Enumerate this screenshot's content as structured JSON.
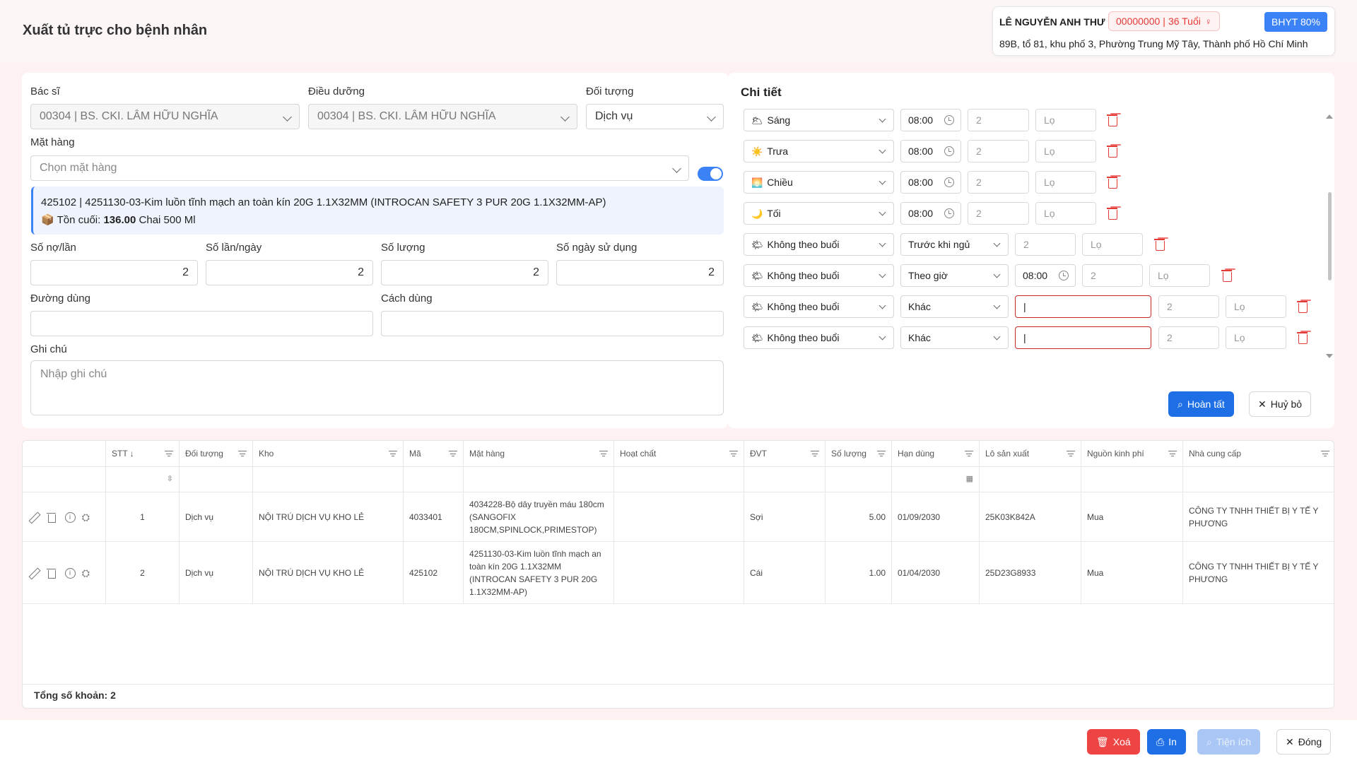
{
  "page": {
    "title": "Xuất tủ trực cho bệnh nhân"
  },
  "patient": {
    "name": "LÊ NGUYỄN ANH THƯ",
    "code": "00000000",
    "age": "36 Tuổi",
    "insurance": "BHYT 80%",
    "address": "89B, tổ 81, khu phố 3, Phường Trung Mỹ Tây, Thành phố Hồ Chí Minh"
  },
  "form": {
    "doctor_label": "Bác sĩ",
    "doctor_value": "00304 | BS. CKI. LÂM HỮU NGHĨA",
    "nurse_label": "Điều dưỡng",
    "nurse_value": "00304 | BS. CKI. LÂM HỮU NGHĨA",
    "object_label": "Đối tượng",
    "object_value": "Dịch vụ",
    "item_label": "Mặt hàng",
    "item_placeholder": "Chọn mặt hàng",
    "toggle_on": true,
    "selected_item": "425102 | 4251130-03-Kim luồn tĩnh mạch an toàn kín 20G 1.1X32MM (INTROCAN SAFETY 3 PUR 20G 1.1X32MM-AP)",
    "stock_label": "Tồn cuối:",
    "stock_value": "136.00",
    "stock_unit": "Chai 500 Ml",
    "dose_label": "Số nợ/lần",
    "dose_value": "2",
    "times_label": "Số lần/ngày",
    "times_value": "2",
    "qty_label": "Số lượng",
    "qty_value": "2",
    "days_label": "Số ngày sử dụng",
    "days_value": "2",
    "route_label": "Đường dùng",
    "route_value": "",
    "usage_label": "Cách dùng",
    "usage_value": "",
    "note_label": "Ghi chú",
    "note_placeholder": "Nhập ghi chú"
  },
  "detail": {
    "title": "Chi tiết",
    "rows": [
      {
        "icon": "🌥",
        "session": "Sáng",
        "time": "08:00",
        "qty": "2",
        "lot": "Lọ"
      },
      {
        "icon": "☀️",
        "session": "Trưa",
        "time": "08:00",
        "qty": "2",
        "lot": "Lọ"
      },
      {
        "icon": "🌅",
        "session": "Chiều",
        "time": "08:00",
        "qty": "2",
        "lot": "Lọ"
      },
      {
        "icon": "🌙",
        "session": "Tối",
        "time": "08:00",
        "qty": "2",
        "lot": "Lọ"
      },
      {
        "icon": "🌤",
        "session": "Không theo buổi",
        "mode": "Trước khi ngủ",
        "qty": "2",
        "lot": "Lọ"
      },
      {
        "icon": "🌤",
        "session": "Không theo buổi",
        "mode": "Theo giờ",
        "time": "08:00",
        "qty": "2",
        "lot": "Lọ"
      },
      {
        "icon": "🌤",
        "session": "Không theo buổi",
        "mode": "Khác",
        "text": "|",
        "qty": "2",
        "lot": "Lọ"
      },
      {
        "icon": "🌤",
        "session": "Không theo buổi",
        "mode": "Khác",
        "text": "|",
        "qty": "2",
        "lot": "Lọ"
      }
    ],
    "complete_label": "Hoàn tất",
    "cancel_label": "Huỷ bỏ"
  },
  "table": {
    "columns": [
      "STT",
      "Đối tượng",
      "Kho",
      "Mã",
      "Mặt hàng",
      "Hoạt chất",
      "ĐVT",
      "Số lượng",
      "Hạn dùng",
      "Lô sản xuất",
      "Nguồn kinh phí",
      "Nhà cung cấp"
    ],
    "rows": [
      {
        "stt": "1",
        "object": "Dịch vụ",
        "warehouse": "NỘI TRÚ DỊCH VỤ KHO LẺ",
        "code": "4033401",
        "item": "4034228-Bộ dây truyền máu 180cm (SANGOFIX 180CM,SPINLOCK,PRIMESTOP)",
        "active": "",
        "unit": "Sợi",
        "qty": "5.00",
        "expiry": "01/09/2030",
        "lot": "25K03K842A",
        "funding": "Mua",
        "supplier": "CÔNG TY TNHH THIẾT BỊ Y TẾ Y PHƯƠNG"
      },
      {
        "stt": "2",
        "object": "Dịch vụ",
        "warehouse": "NỘI TRÚ DỊCH VỤ KHO LẺ",
        "code": "425102",
        "item": "4251130-03-Kim luồn tĩnh mạch an toàn kín 20G 1.1X32MM (INTROCAN SAFETY 3 PUR 20G 1.1X32MM-AP)",
        "active": "",
        "unit": "Cái",
        "qty": "1.00",
        "expiry": "01/04/2030",
        "lot": "25D23G8933",
        "funding": "Mua",
        "supplier": "CÔNG TY TNHH THIẾT BỊ Y TẾ Y PHƯƠNG"
      }
    ],
    "total_label": "Tổng số khoản: 2"
  },
  "footer": {
    "delete_label": "Xoá",
    "print_label": "In",
    "utility_label": "Tiện ích",
    "close_label": "Đóng"
  },
  "colors": {
    "accent": "#1e6fe6",
    "danger": "#ef4444",
    "background": "#fdf1f1"
  }
}
